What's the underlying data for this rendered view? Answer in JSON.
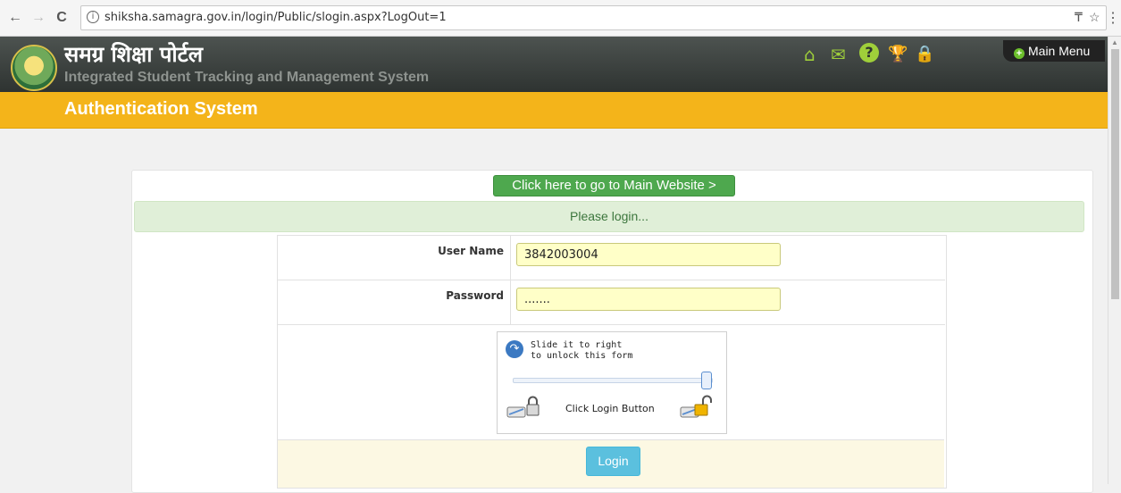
{
  "browser": {
    "back": "←",
    "forward": "→",
    "reload": "C",
    "info": "i",
    "url": "shiksha.samagra.gov.in/login/Public/slogin.aspx?LogOut=1",
    "pin": "₸",
    "star": "☆",
    "menu": "⋮"
  },
  "header": {
    "title": "समग्र शिक्षा पोर्टल",
    "subtitle": "Integrated Student Tracking and Management System",
    "icons": [
      "home-icon",
      "mail-icon",
      "help-icon",
      "trophy-icon",
      "lock-icon"
    ],
    "icon_glyphs": {
      "home": "⌂",
      "mail": "✉",
      "help": "?",
      "trophy": "🏆",
      "lock": "🔒"
    },
    "main_menu_label": "Main Menu",
    "plus": "+"
  },
  "auth_bar": {
    "title": "Authentication System"
  },
  "card": {
    "main_website_link": "Click here to go to Main Website >",
    "login_message": "Please login...",
    "username_label": "User Name",
    "username_value": "3842003004",
    "password_label": "Password",
    "password_value": ".......",
    "slider": {
      "arrow": "↷",
      "line1": "Slide it to right",
      "line2": "to unlock this form",
      "level": 1.0,
      "click_text": "Click Login Button"
    },
    "login_button": "Login"
  },
  "colors": {
    "header_bg": "#3c413f",
    "auth_bar": "#f4b41a",
    "green_button": "#4ea84e",
    "login_button": "#5bc0de",
    "input_bg": "#ffffc8"
  }
}
